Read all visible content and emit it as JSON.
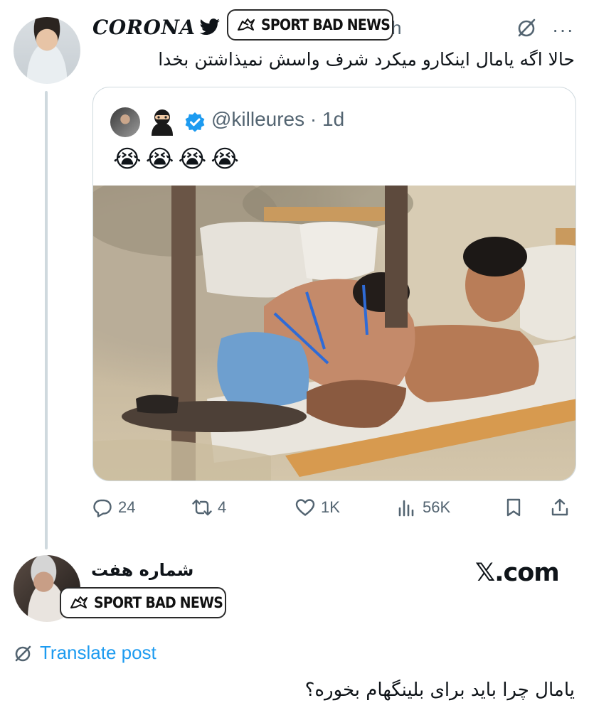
{
  "tweet": {
    "author_name": "CORONA",
    "time_partial": "h",
    "text": "حالا اگه یامال اینکارو میکرد شرف واسش نمیذاشتن بخدا",
    "icons": {
      "verified_badge": "bird-icon",
      "translate": "no-translate-icon",
      "more": "more-icon"
    }
  },
  "watermark": {
    "label": "SPORT BAD NEWS",
    "icon": "wolf-icon"
  },
  "quoted_tweet": {
    "handle": "@killeures",
    "time": "1d",
    "handle_line": "@killeures · 1d",
    "emojis": [
      "😭",
      "😭",
      "😭",
      "😭"
    ],
    "icons": [
      "ninja-icon",
      "verified-icon"
    ]
  },
  "actions": {
    "replies": "24",
    "reposts": "4",
    "likes": "1K",
    "views": "56K"
  },
  "reply": {
    "author_name": "شماره هفت",
    "site_label": "𝕏.com",
    "translate_label": "Translate post",
    "text": "یامال چرا باید برای بلینگهام بخوره؟"
  },
  "colors": {
    "link_blue": "#1d9bf0",
    "muted_gray": "#536471",
    "verified_blue": "#1d9bf0",
    "border": "#cfd9de"
  }
}
